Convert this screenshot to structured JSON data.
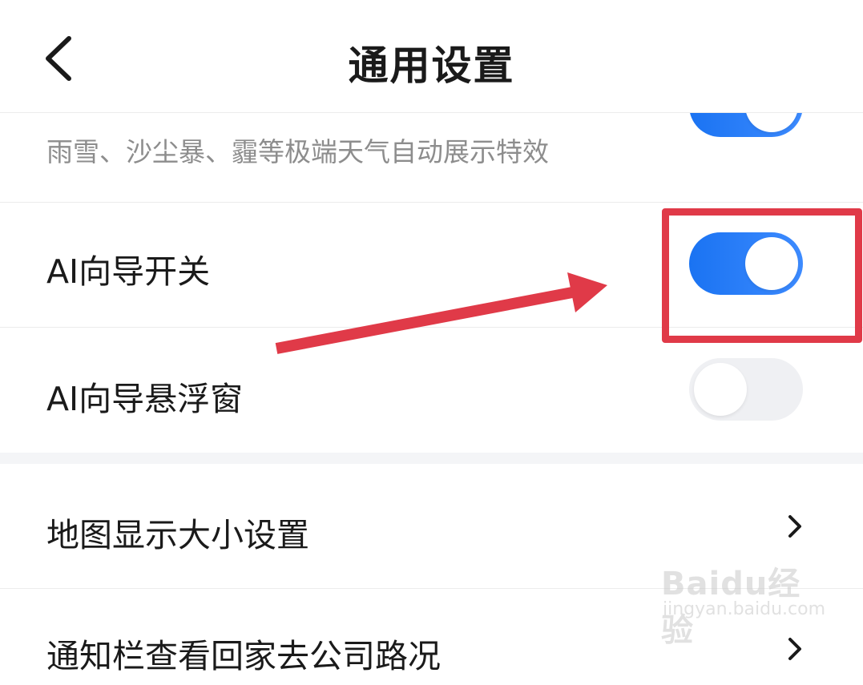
{
  "header": {
    "title": "通用设置",
    "back_icon": "chevron-left-icon"
  },
  "weather_effects": {
    "description": "雨雪、沙尘暴、霾等极端天气自动展示特效",
    "enabled": true
  },
  "ai_guide_switch": {
    "label": "AI向导开关",
    "enabled": true
  },
  "ai_guide_float": {
    "label": "AI向导悬浮窗",
    "enabled": false
  },
  "map_display_size": {
    "label": "地图显示大小设置",
    "icon": "chevron-right-icon"
  },
  "notification_row": {
    "label": "通知栏查看回家去公司路况",
    "icon": "chevron-right-icon"
  },
  "annotation": {
    "color": "#e03a48"
  },
  "toggle_on_color": "#1a73f2",
  "watermark": {
    "brand": "Baidu经验",
    "url": "jingyan.baidu.com"
  }
}
